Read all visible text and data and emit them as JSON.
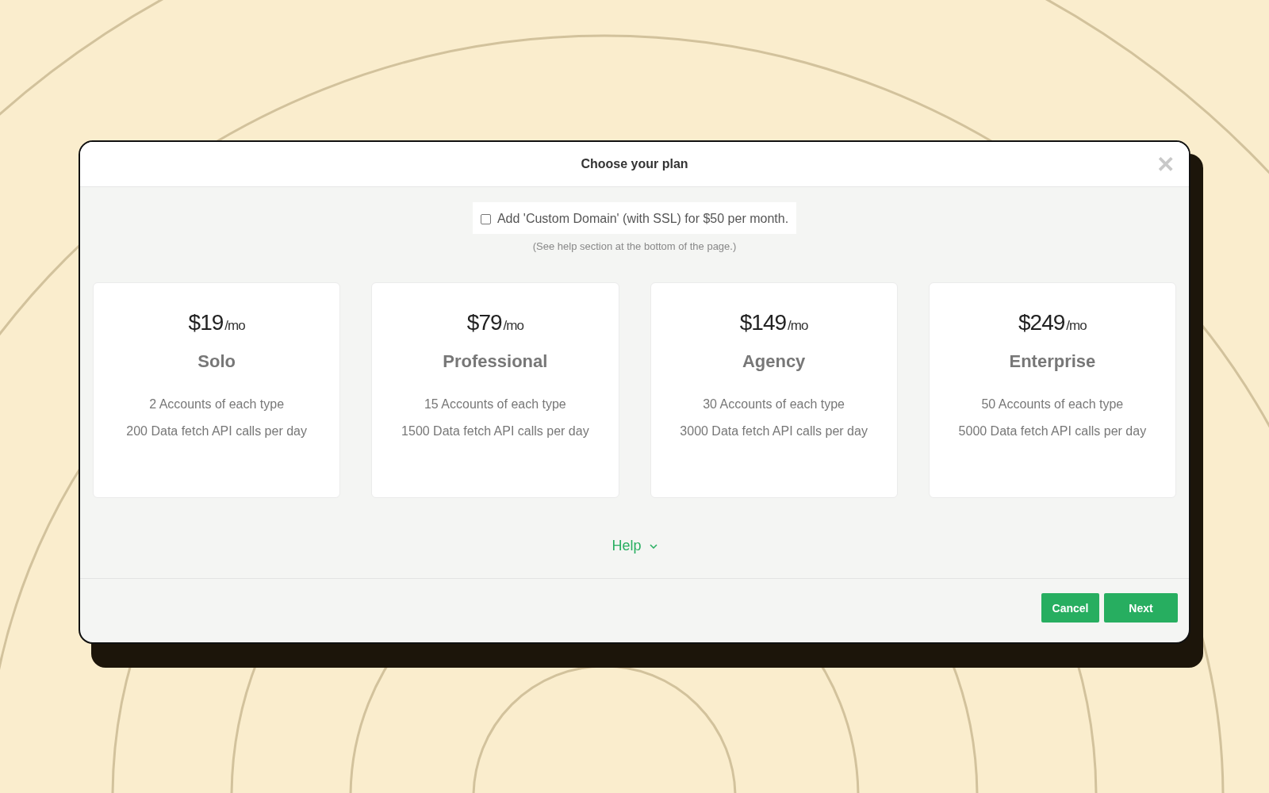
{
  "dialog": {
    "title": "Choose your plan",
    "close_icon": "✕"
  },
  "custom_domain": {
    "label": "Add 'Custom Domain' (with SSL) for $50 per month.",
    "checked": false,
    "note": "(See help section at the bottom of the page.)"
  },
  "plans": [
    {
      "price": "$19",
      "period": "/mo",
      "name": "Solo",
      "features": [
        "2 Accounts of each type",
        "200 Data fetch API calls per day"
      ]
    },
    {
      "price": "$79",
      "period": "/mo",
      "name": "Professional",
      "features": [
        "15 Accounts of each type",
        "1500 Data fetch API calls per day"
      ]
    },
    {
      "price": "$149",
      "period": "/mo",
      "name": "Agency",
      "features": [
        "30 Accounts of each type",
        "3000 Data fetch API calls per day"
      ]
    },
    {
      "price": "$249",
      "period": "/mo",
      "name": "Enterprise",
      "features": [
        "50 Accounts of each type",
        "5000 Data fetch API calls per day"
      ]
    }
  ],
  "help": {
    "label": "Help",
    "expanded": false
  },
  "buttons": [
    "Cancel",
    "Next"
  ]
}
